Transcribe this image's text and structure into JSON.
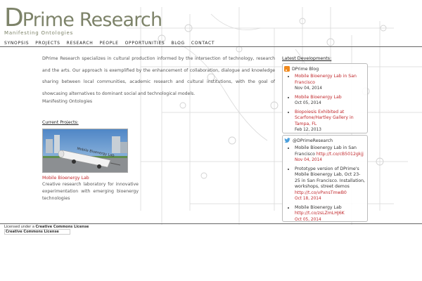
{
  "header": {
    "logo_initial": "D",
    "logo_rest": "Prime Research",
    "tagline": "Manifesting Ontologies"
  },
  "nav": {
    "items": [
      {
        "label": "SYNOPSIS"
      },
      {
        "label": "PROJECTS"
      },
      {
        "label": "RESEARCH"
      },
      {
        "label": "PEOPLE"
      },
      {
        "label": "OPPORTUNITIES"
      },
      {
        "label": "BLOG"
      },
      {
        "label": "CONTACT"
      }
    ]
  },
  "main": {
    "intro": "DPrime Research specializes in cultural production informed by the intersection of technology, research and the arts. Our approach is exemplified by the enhancement of collaboration, dialogue and knowledge sharing between local communities, academic research and cultural institutions, with the goal of showcasing alternatives to dominant social and technological models.",
    "intro_sub": "Manifesting Ontologies",
    "projects_heading": "Current Projects:",
    "project": {
      "thumb_label": "Mobile Bioenergy Lab",
      "title": "Mobile Bioenergy Lab",
      "description": "Creative research laboratory for innovative experimentation with emerging bioenergy technologies"
    }
  },
  "sidebar": {
    "heading": "Latest Developments:",
    "blog": {
      "title": "DPrime Blog",
      "icon": "rss-icon",
      "items": [
        {
          "text": "Mobile Bioenergy Lab in San Francisco",
          "date": "Nov 04, 2014"
        },
        {
          "text": "Mobile Bioenergy Lab",
          "date": "Oct 05, 2014"
        },
        {
          "text": "Biopoiesis Exhibited at Scarfone/Hartley Gallery in Tampa, FL",
          "date": "Feb 12, 2013"
        }
      ]
    },
    "twitter": {
      "title": "@DPrimeResearch",
      "icon": "twitter-icon",
      "items": [
        {
          "text": "Mobile Bioenergy Lab in San Francisco ",
          "link": "http://t.co/cB5012gkjj",
          "date": "Nov 04, 2014"
        },
        {
          "text": "Prototype version of DPrime's Mobile Bioenergy Lab, Oct 23-25 in San Francisco. Installation, workshops, street demos ",
          "link": "http://t.co/vPxnsTmwB0",
          "date": "Oct 18, 2014"
        },
        {
          "text": "Mobile Bioenergy Lab ",
          "link": "http://t.co/zsLZmLHJ6K",
          "date": "Oct 05, 2014"
        }
      ]
    }
  },
  "footer": {
    "license_prefix": "Licensed under a ",
    "license_name": "Creative Commons License",
    "badge_text": "Creative Commons License"
  },
  "colors": {
    "brand": "#7d8369",
    "link": "#c0262a",
    "rss": "#f0891d",
    "twitter": "#4a9fdc"
  }
}
